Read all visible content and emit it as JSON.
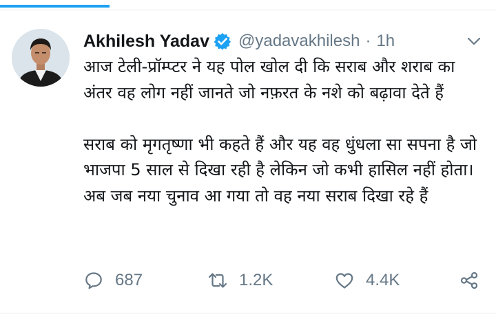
{
  "tweet": {
    "author_name": "Akhilesh Yadav",
    "handle": "@yadavakhilesh",
    "separator": "·",
    "time": "1h",
    "verified": true,
    "paragraphs": [
      "आज टेली-प्रॉम्प्टर ने यह पोल खोल दी कि सराब और शराब का अंतर वह लोग नहीं जानते जो नफ़रत के नशे को बढ़ावा देते हैं",
      "सराब को मृगतृष्णा भी कहते हैं और यह वह धुंधला सा सपना है जो भाजपा 5 साल से दिखा रही है लेकिन जो कभी हासिल नहीं होता। अब जब नया चुनाव आ गया तो वह नया सराब दिखा रहे हैं"
    ],
    "actions": {
      "replies": "687",
      "retweets": "1.2K",
      "likes": "4.4K"
    }
  },
  "icons": {
    "verified": "verified-badge-icon",
    "menu": "chevron-down-icon",
    "reply": "reply-icon",
    "retweet": "retweet-icon",
    "like": "heart-icon",
    "share": "share-icon"
  },
  "colors": {
    "accent": "#1da1f2",
    "text": "#14171a",
    "secondary": "#657786",
    "divider": "#e6ecf0"
  }
}
